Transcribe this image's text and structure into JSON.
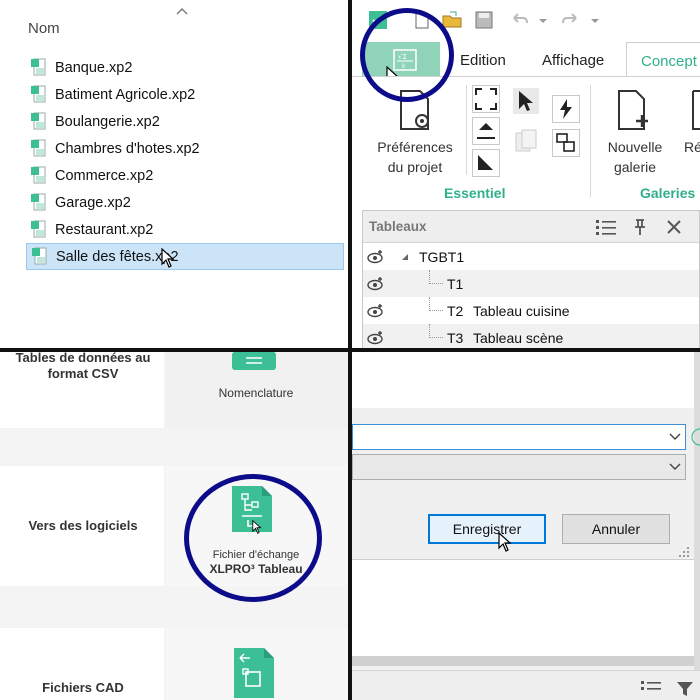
{
  "explorer": {
    "column_name": "Nom",
    "files": [
      {
        "name": "Banque.xp2"
      },
      {
        "name": "Batiment Agricole.xp2"
      },
      {
        "name": "Boulangerie.xp2"
      },
      {
        "name": "Chambres d'hotes.xp2"
      },
      {
        "name": "Commerce.xp2"
      },
      {
        "name": "Garage.xp2"
      },
      {
        "name": "Restaurant.xp2"
      },
      {
        "name": "Salle des fêtes.xp2"
      }
    ],
    "selected_index": 7
  },
  "ribbon": {
    "tabs": {
      "edition": "Edition",
      "affichage": "Affichage",
      "conception": "Concept"
    },
    "buttons": {
      "project_prefs_line1": "Préférences",
      "project_prefs_line2": "du projet",
      "new_gallery_line1": "Nouvelle",
      "new_gallery_line2": "galerie",
      "cut_off": "Ré"
    },
    "groups": {
      "essentiel": "Essentiel",
      "galeries": "Galeries"
    },
    "panel": {
      "title": "Tableaux",
      "tree": [
        {
          "code": "TGBT1",
          "label": ""
        },
        {
          "code": "T1",
          "label": ""
        },
        {
          "code": "T2",
          "label": "Tableau cuisine"
        },
        {
          "code": "T3",
          "label": "Tableau scène"
        }
      ]
    }
  },
  "export": {
    "rows": [
      {
        "label": "Tables de données au format CSV",
        "caption": "Nomenclature",
        "caption_bold": ""
      },
      {
        "label": "Vers des logiciels",
        "caption": "Fichier d'échange",
        "caption_bold": "XLPRO³ Tableau"
      },
      {
        "label": "Fichiers CAD",
        "caption": "",
        "caption_bold": ""
      }
    ]
  },
  "dialog": {
    "save_button": "Enregistrer",
    "cancel_button": "Annuler"
  },
  "colors": {
    "accent": "#3cbf95",
    "highlight_circle": "#0c0c8a",
    "selection": "#cce4f7"
  }
}
